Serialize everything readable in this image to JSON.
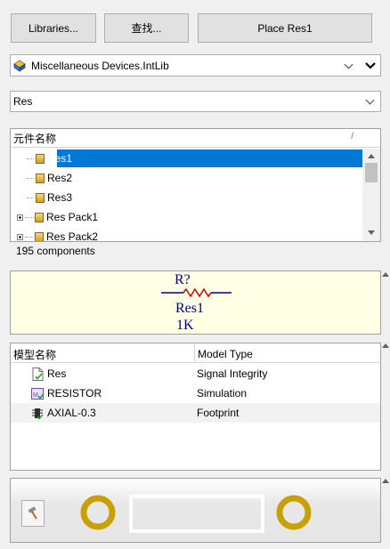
{
  "toolbar": {
    "libraries_label": "Libraries...",
    "find_label": "查找...",
    "place_label": "Place Res1"
  },
  "library_select": {
    "value": "Miscellaneous Devices.IntLib"
  },
  "filter": {
    "value": "Res"
  },
  "component_list": {
    "header": "元件名称",
    "items": [
      {
        "label": "Res1",
        "selected": true
      },
      {
        "label": "Res2",
        "selected": false
      },
      {
        "label": "Res3",
        "selected": false
      },
      {
        "label": "Res Pack1",
        "selected": false
      },
      {
        "label": "Res Pack2",
        "selected": false
      }
    ],
    "count_text": "195 components"
  },
  "symbol_preview": {
    "designator": "R?",
    "name": "Res1",
    "value": "1K",
    "colors": {
      "text": "#000080",
      "wire": "#000080",
      "zigzag": "#cc0000",
      "background": "#ffffe6"
    }
  },
  "models": {
    "col_name": "模型名称",
    "col_type": "Model Type",
    "rows": [
      {
        "name": "Res",
        "type": "Signal Integrity",
        "icon": "signal-integrity-icon"
      },
      {
        "name": "RESISTOR",
        "type": "Simulation",
        "icon": "simulation-icon"
      },
      {
        "name": "AXIAL-0.3",
        "type": "Footprint",
        "icon": "footprint-icon"
      }
    ]
  },
  "footprint_preview": {
    "tool_icon": "hammer-icon",
    "colors": {
      "pad": "#c8a000",
      "outline": "#ffffff",
      "background": "#f0f0f0"
    }
  }
}
